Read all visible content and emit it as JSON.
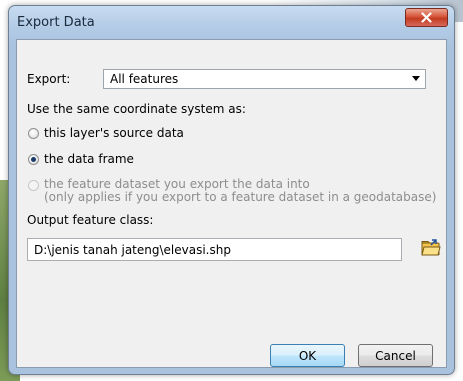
{
  "window": {
    "title": "Export Data",
    "close_icon": "close-x-icon"
  },
  "export": {
    "label": "Export:",
    "selected": "All features"
  },
  "coordinate_system": {
    "heading": "Use the same coordinate system as:",
    "options": [
      {
        "label": "this layer's source data",
        "checked": false,
        "enabled": true
      },
      {
        "label": "the data frame",
        "checked": true,
        "enabled": true
      },
      {
        "label": "the feature dataset you export the data into",
        "sublabel": "(only applies if you export to a feature dataset in a geodatabase)",
        "checked": false,
        "enabled": false
      }
    ]
  },
  "output": {
    "label": "Output feature class:",
    "path": "D:\\jenis tanah jateng\\elevasi.shp",
    "browse_icon": "open-folder-icon"
  },
  "buttons": {
    "ok": "OK",
    "cancel": "Cancel"
  },
  "colors": {
    "title_gradient": "#b4cce6",
    "close_button": "#c13b20",
    "client_bg": "#f0f0f0",
    "radio_dot": "#1a3a6c",
    "disabled_text": "#8d8d8d",
    "default_button": "#bee6fd"
  }
}
